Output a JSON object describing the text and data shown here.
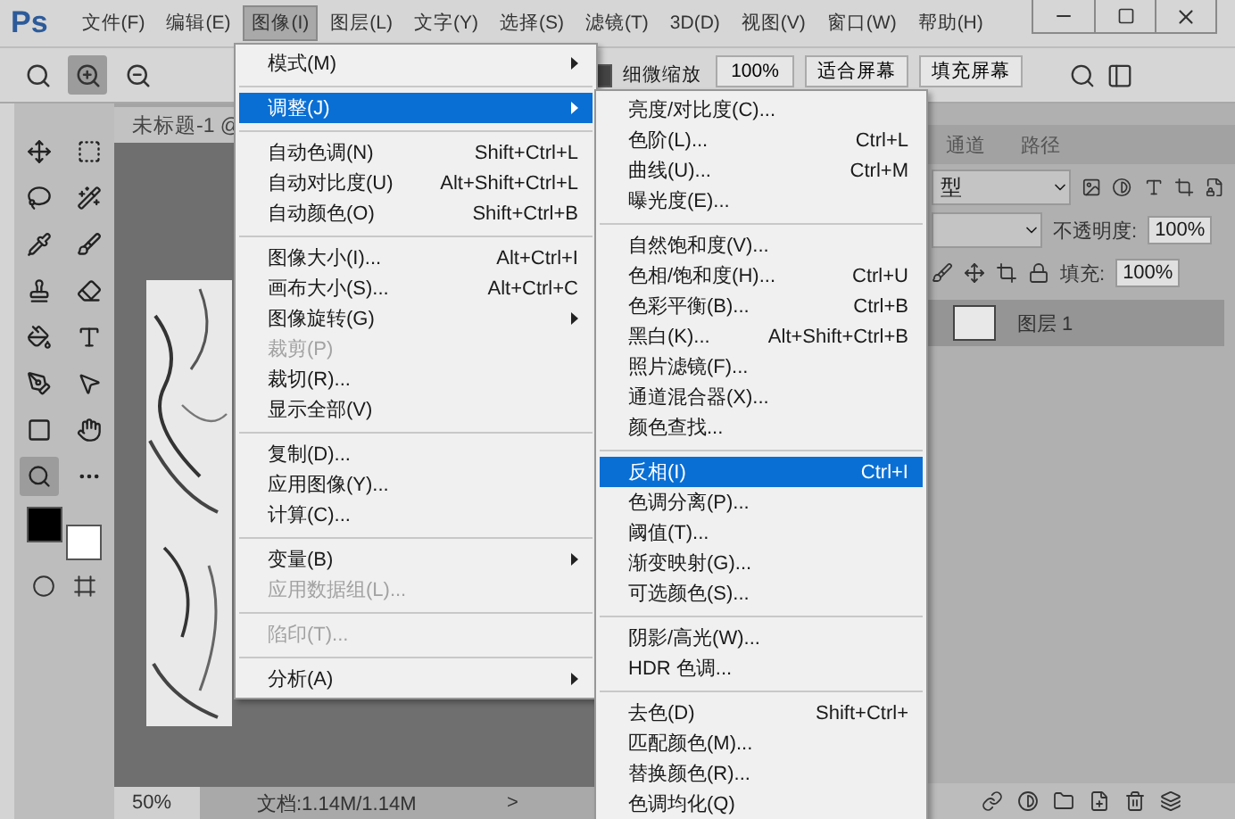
{
  "app_logo": "Ps",
  "menubar": [
    {
      "label": "文件(F)",
      "selected": false
    },
    {
      "label": "编辑(E)",
      "selected": false
    },
    {
      "label": "图像(I)",
      "selected": true
    },
    {
      "label": "图层(L)",
      "selected": false
    },
    {
      "label": "文字(Y)",
      "selected": false
    },
    {
      "label": "选择(S)",
      "selected": false
    },
    {
      "label": "滤镜(T)",
      "selected": false
    },
    {
      "label": "3D(D)",
      "selected": false
    },
    {
      "label": "视图(V)",
      "selected": false
    },
    {
      "label": "窗口(W)",
      "selected": false
    },
    {
      "label": "帮助(H)",
      "selected": false
    }
  ],
  "options_bar": {
    "fine_zoom": {
      "label": "细微缩放",
      "checked": true
    },
    "buttons": [
      "100%",
      "适合屏幕",
      "填充屏幕"
    ]
  },
  "document": {
    "tab": "未标题-1 @",
    "zoom": "50%",
    "doc_info": "文档:1.14M/1.14M",
    "arrow": ">"
  },
  "layers_panel": {
    "tabs": [
      {
        "label": "通道",
        "selected": false
      },
      {
        "label": "路径",
        "selected": false
      }
    ],
    "filter_kind": "型",
    "opacity_label": "不透明度:",
    "opacity": "100%",
    "fill_label": "填充:",
    "fill": "100%",
    "layers": [
      {
        "name": "图层 1",
        "selected": true
      }
    ]
  },
  "image_menu": [
    [
      {
        "label": "模式(M)",
        "submenu": true,
        "disabled": false,
        "selected": false
      }
    ],
    [
      {
        "label": "调整(J)",
        "submenu": true,
        "disabled": false,
        "selected": true
      }
    ],
    [
      {
        "label": "自动色调(N)",
        "shortcut": "Shift+Ctrl+L",
        "submenu": false,
        "disabled": false,
        "selected": false
      },
      {
        "label": "自动对比度(U)",
        "shortcut": "Alt+Shift+Ctrl+L",
        "submenu": false,
        "disabled": false,
        "selected": false
      },
      {
        "label": "自动颜色(O)",
        "shortcut": "Shift+Ctrl+B",
        "submenu": false,
        "disabled": false,
        "selected": false
      }
    ],
    [
      {
        "label": "图像大小(I)...",
        "shortcut": "Alt+Ctrl+I",
        "submenu": false,
        "disabled": false,
        "selected": false
      },
      {
        "label": "画布大小(S)...",
        "shortcut": "Alt+Ctrl+C",
        "submenu": false,
        "disabled": false,
        "selected": false
      },
      {
        "label": "图像旋转(G)",
        "submenu": true,
        "disabled": false,
        "selected": false
      },
      {
        "label": "裁剪(P)",
        "submenu": false,
        "disabled": true,
        "selected": false
      },
      {
        "label": "裁切(R)...",
        "submenu": false,
        "disabled": false,
        "selected": false
      },
      {
        "label": "显示全部(V)",
        "submenu": false,
        "disabled": false,
        "selected": false
      }
    ],
    [
      {
        "label": "复制(D)...",
        "submenu": false,
        "disabled": false,
        "selected": false
      },
      {
        "label": "应用图像(Y)...",
        "submenu": false,
        "disabled": false,
        "selected": false
      },
      {
        "label": "计算(C)...",
        "submenu": false,
        "disabled": false,
        "selected": false
      }
    ],
    [
      {
        "label": "变量(B)",
        "submenu": true,
        "disabled": false,
        "selected": false
      },
      {
        "label": "应用数据组(L)...",
        "submenu": false,
        "disabled": true,
        "selected": false
      }
    ],
    [
      {
        "label": "陷印(T)...",
        "submenu": false,
        "disabled": true,
        "selected": false
      }
    ],
    [
      {
        "label": "分析(A)",
        "submenu": true,
        "disabled": false,
        "selected": false
      }
    ]
  ],
  "adjust_submenu": [
    [
      {
        "label": "亮度/对比度(C)...",
        "submenu": false,
        "disabled": false,
        "selected": false
      },
      {
        "label": "色阶(L)...",
        "shortcut": "Ctrl+L",
        "submenu": false,
        "disabled": false,
        "selected": false
      },
      {
        "label": "曲线(U)...",
        "shortcut": "Ctrl+M",
        "submenu": false,
        "disabled": false,
        "selected": false
      },
      {
        "label": "曝光度(E)...",
        "submenu": false,
        "disabled": false,
        "selected": false
      }
    ],
    [
      {
        "label": "自然饱和度(V)...",
        "submenu": false,
        "disabled": false,
        "selected": false
      },
      {
        "label": "色相/饱和度(H)...",
        "shortcut": "Ctrl+U",
        "submenu": false,
        "disabled": false,
        "selected": false
      },
      {
        "label": "色彩平衡(B)...",
        "shortcut": "Ctrl+B",
        "submenu": false,
        "disabled": false,
        "selected": false
      },
      {
        "label": "黑白(K)...",
        "shortcut": "Alt+Shift+Ctrl+B",
        "submenu": false,
        "disabled": false,
        "selected": false
      },
      {
        "label": "照片滤镜(F)...",
        "submenu": false,
        "disabled": false,
        "selected": false
      },
      {
        "label": "通道混合器(X)...",
        "submenu": false,
        "disabled": false,
        "selected": false
      },
      {
        "label": "颜色查找...",
        "submenu": false,
        "disabled": false,
        "selected": false
      }
    ],
    [
      {
        "label": "反相(I)",
        "shortcut": "Ctrl+I",
        "submenu": false,
        "disabled": false,
        "selected": true
      },
      {
        "label": "色调分离(P)...",
        "submenu": false,
        "disabled": false,
        "selected": false
      },
      {
        "label": "阈值(T)...",
        "submenu": false,
        "disabled": false,
        "selected": false
      },
      {
        "label": "渐变映射(G)...",
        "submenu": false,
        "disabled": false,
        "selected": false
      },
      {
        "label": "可选颜色(S)...",
        "submenu": false,
        "disabled": false,
        "selected": false
      }
    ],
    [
      {
        "label": "阴影/高光(W)...",
        "submenu": false,
        "disabled": false,
        "selected": false
      },
      {
        "label": "HDR 色调...",
        "submenu": false,
        "disabled": false,
        "selected": false
      }
    ],
    [
      {
        "label": "去色(D)",
        "shortcut": "Shift+Ctrl+",
        "submenu": false,
        "disabled": false,
        "selected": false
      },
      {
        "label": "匹配颜色(M)...",
        "submenu": false,
        "disabled": false,
        "selected": false
      },
      {
        "label": "替换颜色(R)...",
        "submenu": false,
        "disabled": false,
        "selected": false
      },
      {
        "label": "色调均化(Q)",
        "submenu": false,
        "disabled": false,
        "selected": false
      }
    ]
  ]
}
